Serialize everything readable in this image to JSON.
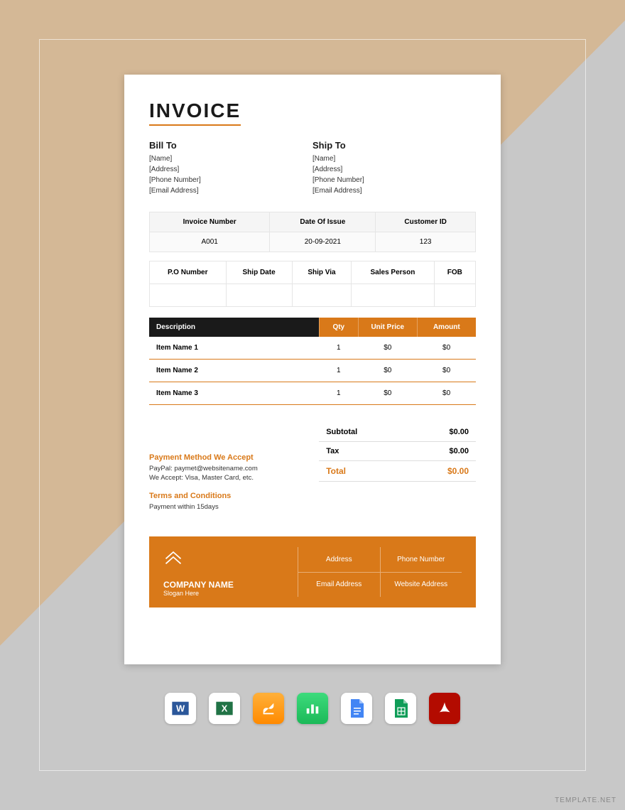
{
  "title": "INVOICE",
  "billTo": {
    "heading": "Bill To",
    "name": "[Name]",
    "address": "[Address]",
    "phone": "[Phone Number]",
    "email": "[Email Address]"
  },
  "shipTo": {
    "heading": "Ship To",
    "name": "[Name]",
    "address": "[Address]",
    "phone": "[Phone Number]",
    "email": "[Email Address]"
  },
  "meta": {
    "h1": "Invoice Number",
    "v1": "A001",
    "h2": "Date Of Issue",
    "v2": "20-09-2021",
    "h3": "Customer ID",
    "v3": "123"
  },
  "ship": {
    "h1": "P.O Number",
    "h2": "Ship Date",
    "h3": "Ship Via",
    "h4": "Sales Person",
    "h5": "FOB"
  },
  "itemsHead": {
    "c1": "Description",
    "c2": "Qty",
    "c3": "Unit Price",
    "c4": "Amount"
  },
  "items": [
    {
      "desc": "Item Name 1",
      "qty": "1",
      "price": "$0",
      "amt": "$0"
    },
    {
      "desc": "Item Name 2",
      "qty": "1",
      "price": "$0",
      "amt": "$0"
    },
    {
      "desc": "Item Name 3",
      "qty": "1",
      "price": "$0",
      "amt": "$0"
    }
  ],
  "totals": {
    "subL": "Subtotal",
    "subV": "$0.00",
    "taxL": "Tax",
    "taxV": "$0.00",
    "totL": "Total",
    "totV": "$0.00"
  },
  "payment": {
    "heading": "Payment Method We Accept",
    "l1": "PayPal: paymet@websitename.com",
    "l2": "We Accept: Visa, Master Card, etc."
  },
  "terms": {
    "heading": "Terms and Conditions",
    "text": "Payment within 15days"
  },
  "footer": {
    "company": "COMPANY NAME",
    "slogan": "Slogan Here",
    "c1": "Address",
    "c2": "Phone Number",
    "c3": "Email Address",
    "c4": "Website Address"
  },
  "watermark": "TEMPLATE.NET"
}
